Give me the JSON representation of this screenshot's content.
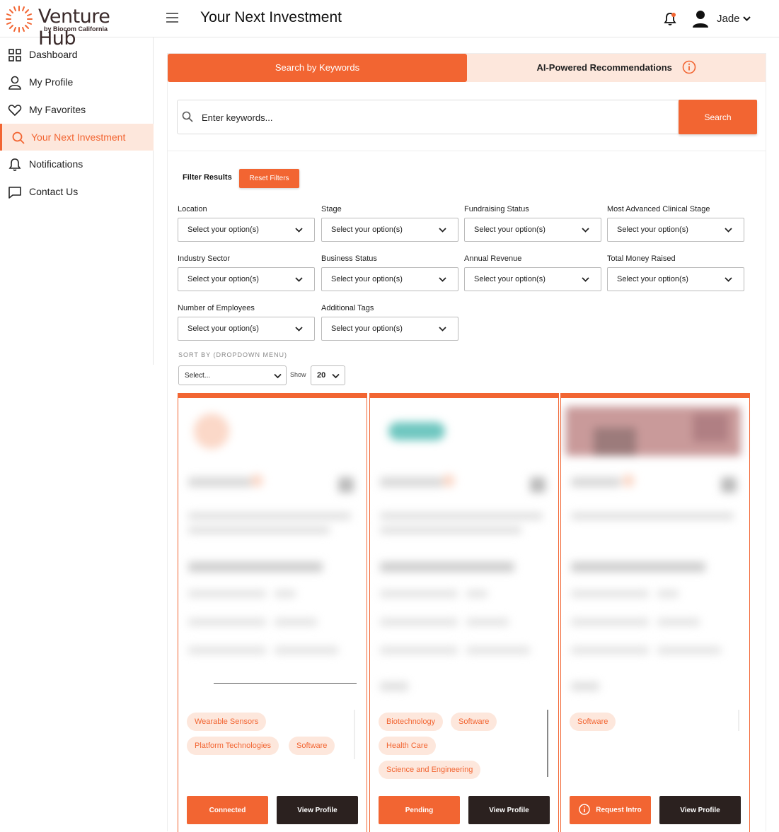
{
  "header": {
    "brand": "Venture Hub",
    "brand_sub": "by Biocom California",
    "title": "Your Next Investment",
    "user_name": "Jade"
  },
  "sidebar": {
    "items": [
      {
        "label": "Dashboard",
        "icon": "grid-icon",
        "active": false
      },
      {
        "label": "My Profile",
        "icon": "user-icon",
        "active": false
      },
      {
        "label": "My Favorites",
        "icon": "heart-icon",
        "active": false
      },
      {
        "label": "Your Next Investment",
        "icon": "search-icon",
        "active": true
      },
      {
        "label": "Notifications",
        "icon": "bell-icon",
        "active": false
      },
      {
        "label": "Contact Us",
        "icon": "chat-icon",
        "active": false
      }
    ]
  },
  "tabs": {
    "keywords": "Search by Keywords",
    "ai": "AI-Powered Recommendations"
  },
  "search": {
    "placeholder": "Enter keywords...",
    "button": "Search"
  },
  "filters": {
    "title": "Filter Results",
    "reset": "Reset Filters",
    "fields": [
      {
        "label": "Location",
        "value": "Select your option(s)"
      },
      {
        "label": "Stage",
        "value": "Select your option(s)"
      },
      {
        "label": "Fundraising Status",
        "value": "Select your option(s)"
      },
      {
        "label": "Most Advanced Clinical Stage",
        "value": "Select your option(s)"
      },
      {
        "label": "Industry Sector",
        "value": "Select your option(s)"
      },
      {
        "label": "Business Status",
        "value": "Select your option(s)"
      },
      {
        "label": "Annual Revenue",
        "value": "Select your option(s)"
      },
      {
        "label": "Total Money Raised",
        "value": "Select your option(s)"
      },
      {
        "label": "Number of Employees",
        "value": "Select your option(s)"
      },
      {
        "label": "Additional Tags",
        "value": "Select your option(s)"
      }
    ]
  },
  "sort": {
    "label": "SORT BY (DROPDOWN MENU)",
    "value": "Select...",
    "show_label": "Show",
    "show_value": "20"
  },
  "cards": [
    {
      "tags": [
        "Wearable Sensors",
        "Platform Technologies",
        "Software"
      ],
      "primary": "Connected",
      "secondary": "View Profile"
    },
    {
      "tags": [
        "Biotechnology",
        "Software",
        "Health Care",
        "Science and Engineering"
      ],
      "primary": "Pending",
      "secondary": "View Profile"
    },
    {
      "tags": [
        "Software"
      ],
      "primary": "Request Intro",
      "secondary": "View Profile"
    }
  ],
  "colors": {
    "accent": "#f26532",
    "accent_light": "#fde7dc",
    "dark": "#2b211f"
  }
}
